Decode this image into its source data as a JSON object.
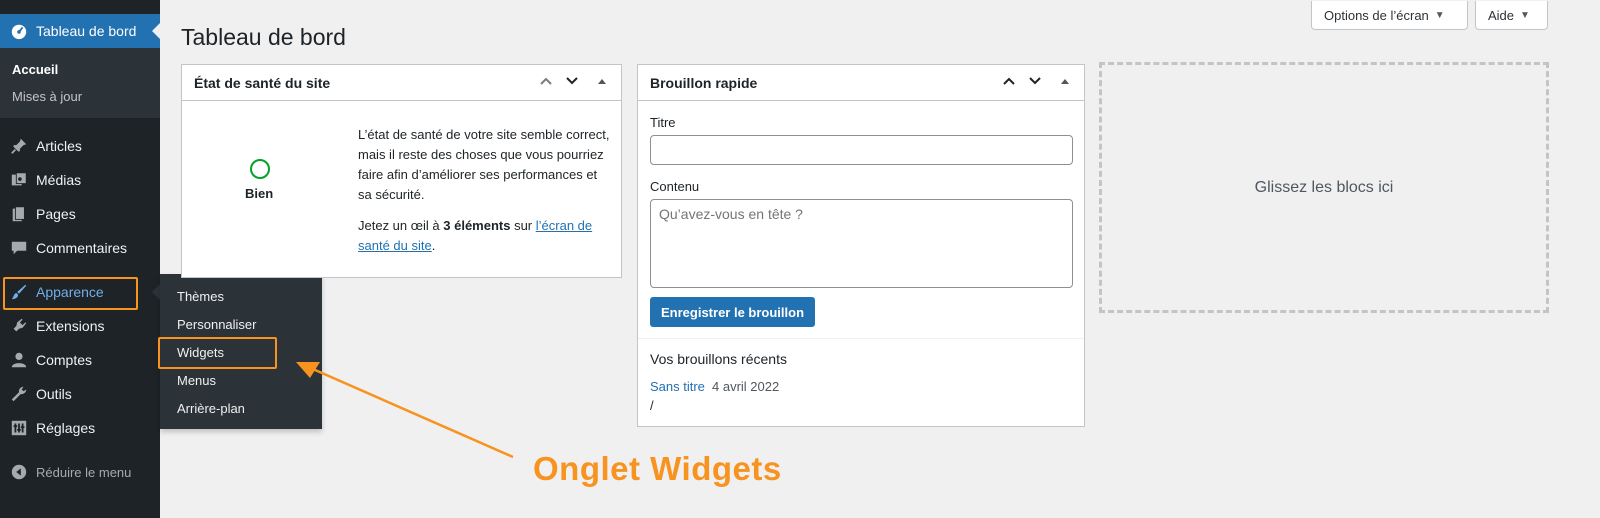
{
  "sidebar": {
    "dashboard_label": "Tableau de bord",
    "submenu": {
      "home": "Accueil",
      "updates": "Mises à jour"
    },
    "items": [
      {
        "label": "Articles",
        "icon": "pin-icon"
      },
      {
        "label": "Médias",
        "icon": "media-icon"
      },
      {
        "label": "Pages",
        "icon": "pages-icon"
      },
      {
        "label": "Commentaires",
        "icon": "comment-icon"
      },
      {
        "label": "Apparence",
        "icon": "paintbrush-icon"
      },
      {
        "label": "Extensions",
        "icon": "plugin-icon"
      },
      {
        "label": "Comptes",
        "icon": "user-icon"
      },
      {
        "label": "Outils",
        "icon": "wrench-icon"
      },
      {
        "label": "Réglages",
        "icon": "settings-icon"
      }
    ],
    "collapse_label": "Réduire le menu"
  },
  "flyout": {
    "items": [
      "Thèmes",
      "Personnaliser",
      "Widgets",
      "Menus",
      "Arrière-plan"
    ]
  },
  "header": {
    "title": "Tableau de bord",
    "screen_options": "Options de l’écran",
    "help": "Aide"
  },
  "health_widget": {
    "title": "État de santé du site",
    "status": "Bien",
    "status_color": "#00a32a",
    "description": "L’état de santé de votre site semble correct, mais il reste des choses que vous pourriez faire afin d’améliorer ses performances et sa sécurité.",
    "cta_prefix": "Jetez un œil à ",
    "cta_count": "3 éléments",
    "cta_middle": " sur ",
    "cta_link": "l’écran de santé du site",
    "cta_suffix": "."
  },
  "quick_draft": {
    "title": "Brouillon rapide",
    "title_label": "Titre",
    "title_value": "",
    "content_label": "Contenu",
    "content_placeholder": "Qu’avez-vous en tête ?",
    "save_button": "Enregistrer le brouillon",
    "recent_title": "Vos brouillons récents",
    "recent": [
      {
        "title": "Sans titre",
        "date": "4 avril 2022",
        "excerpt": "/"
      }
    ]
  },
  "dropzone_label": "Glissez les blocs ici",
  "annotation": {
    "text": "Onglet Widgets",
    "color": "#f7931e"
  },
  "colors": {
    "accent": "#2271b1",
    "sidebar_bg": "#1d2327",
    "highlight": "#f7931e"
  }
}
